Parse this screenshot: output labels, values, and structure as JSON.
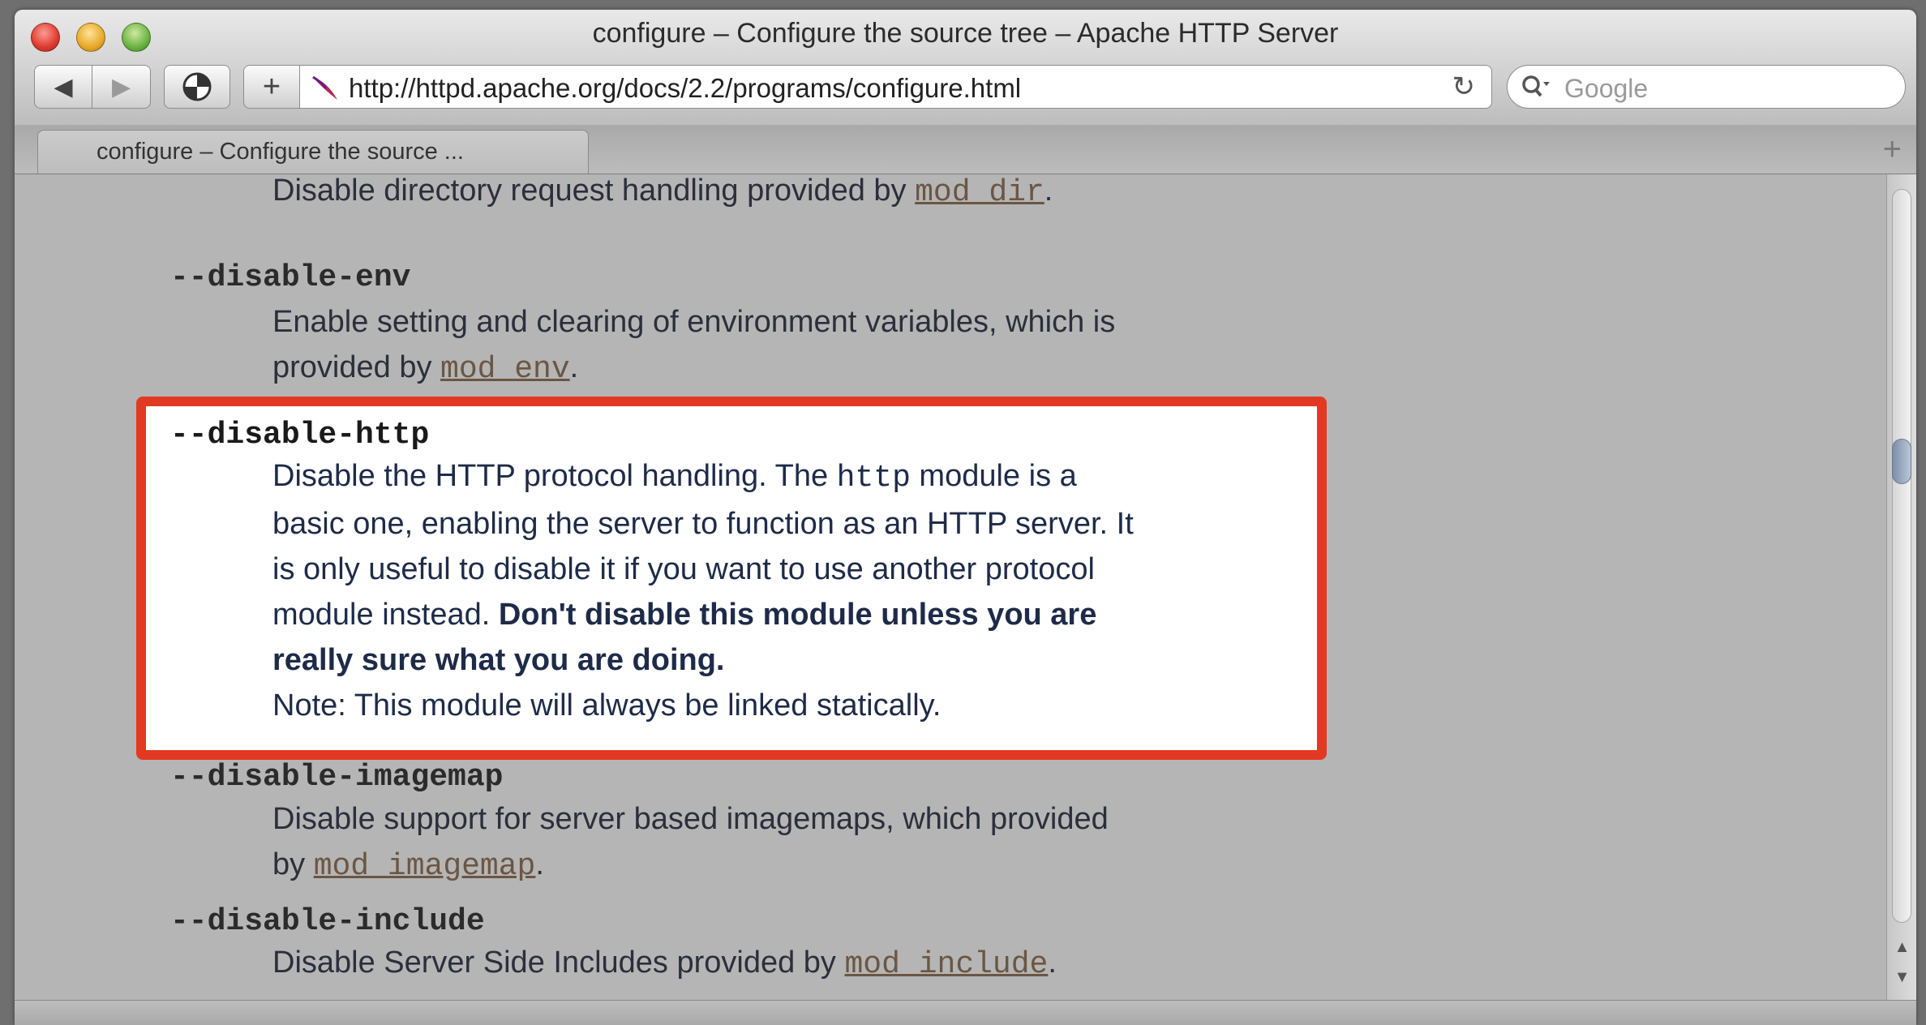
{
  "window": {
    "title": "configure – Configure the source tree – Apache HTTP Server"
  },
  "toolbar": {
    "back_label": "◀",
    "forward_label": "▶",
    "add_label": "+",
    "url": "http://httpd.apache.org/docs/2.2/programs/configure.html",
    "reload_label": "↻",
    "search_placeholder": "Google"
  },
  "tabs": [
    {
      "label": "configure – Configure the source ..."
    }
  ],
  "tabbar": {
    "new_tab_label": "+"
  },
  "entries": {
    "dir": {
      "desc_prefix": "Disable directory request handling provided by ",
      "link": "mod_dir",
      "desc_suffix": "."
    },
    "env": {
      "term": "--disable-env",
      "desc_line1": "Enable setting and clearing of environment variables, which is",
      "desc_line2_prefix": "provided by ",
      "link": "mod_env",
      "desc_suffix": "."
    },
    "http": {
      "term": "--disable-http",
      "line1_prefix": "Disable the HTTP protocol handling. The ",
      "line1_code": "http",
      "line1_suffix": " module is a",
      "line2": "basic one, enabling the server to function as an HTTP server. It",
      "line3": "is only useful to disable it if you want to use another protocol",
      "line4_prefix": "module instead. ",
      "line4_bold": "Don't disable this module unless you are",
      "line5_bold": "really sure what you are doing.",
      "line6": "Note: This module will always be linked statically."
    },
    "imagemap": {
      "term": "--disable-imagemap",
      "desc_line1": "Disable support for server based imagemaps, which provided",
      "desc_line2_prefix": "by ",
      "link": "mod_imagemap",
      "desc_suffix": "."
    },
    "include": {
      "term": "--disable-include",
      "desc_prefix": "Disable Server Side Includes provided by ",
      "link": "mod_include",
      "desc_suffix": "."
    }
  },
  "colors": {
    "highlight_border": "#e23a22",
    "link": "#6b5643"
  }
}
